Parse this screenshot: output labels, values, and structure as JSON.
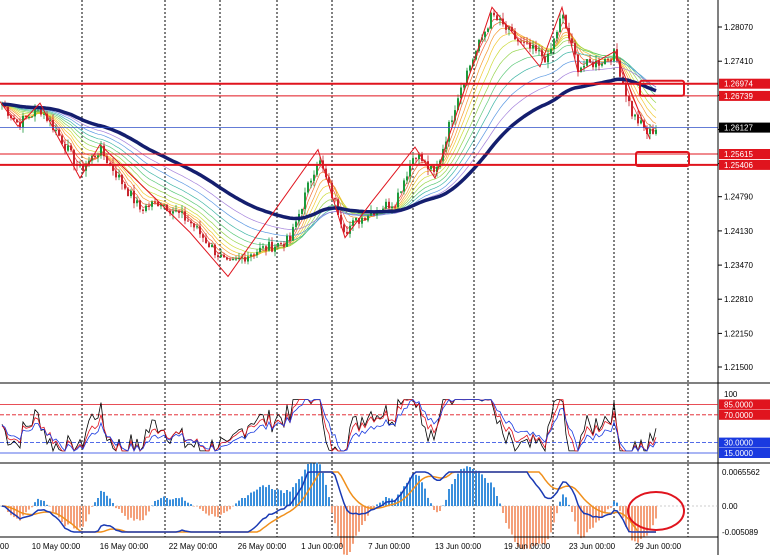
{
  "chart_data": {
    "type": "candlestick",
    "symbol_hidden": true,
    "price_axis": {
      "ticks": [
        "1.28070",
        "1.27410",
        "1.26750",
        "1.26090",
        "1.25430",
        "1.24790",
        "1.24130",
        "1.23470",
        "1.22810",
        "1.22150",
        "1.21500"
      ],
      "range": [
        1.215,
        1.284
      ]
    },
    "price_labels": [
      {
        "text": "1.26974",
        "value": 1.26974,
        "color": "#e0141e"
      },
      {
        "text": "1.26739",
        "value": 1.26739,
        "color": "#e0141e"
      },
      {
        "text": "1.26127",
        "value": 1.26127,
        "color": "#000000"
      },
      {
        "text": "1.25615",
        "value": 1.25615,
        "color": "#e0141e"
      },
      {
        "text": "1.25406",
        "value": 1.25406,
        "color": "#e0141e"
      }
    ],
    "time_axis": [
      "10 May 00:00",
      "16 May 00:00",
      "22 May 00:00",
      "26 May 00:00",
      "1 Jun 00:00",
      "7 Jun 00:00",
      "13 Jun 00:00",
      "19 Jun 00:00",
      "23 Jun 00:00",
      "29 Jun 00:00"
    ],
    "first_time_label_fragment": "00",
    "rsi": {
      "levels": [
        {
          "text": "100",
          "value": 100,
          "color": "#000000"
        },
        {
          "text": "85.0000",
          "value": 85,
          "color": "#e0141e"
        },
        {
          "text": "70.0000",
          "value": 70,
          "color": "#e0141e"
        },
        {
          "text": "30.0000",
          "value": 30,
          "color": "#1a3ae0"
        },
        {
          "text": "15.0000",
          "value": 15,
          "color": "#1a3ae0"
        }
      ]
    },
    "macd": {
      "ticks": [
        "0.0065562",
        "0.00",
        "-0.005089"
      ]
    },
    "colors": {
      "bull": "#1c9a3c",
      "bear": "#c8262e",
      "ema_main": "#141e6e",
      "support_resistance": "#e0141e",
      "current_price_line": "#3050c8",
      "histogram_pos": "#3a8fdc",
      "histogram_neg": "#f4a07a",
      "macd_line": "#1a3ab4",
      "signal_line": "#f0901c"
    }
  }
}
